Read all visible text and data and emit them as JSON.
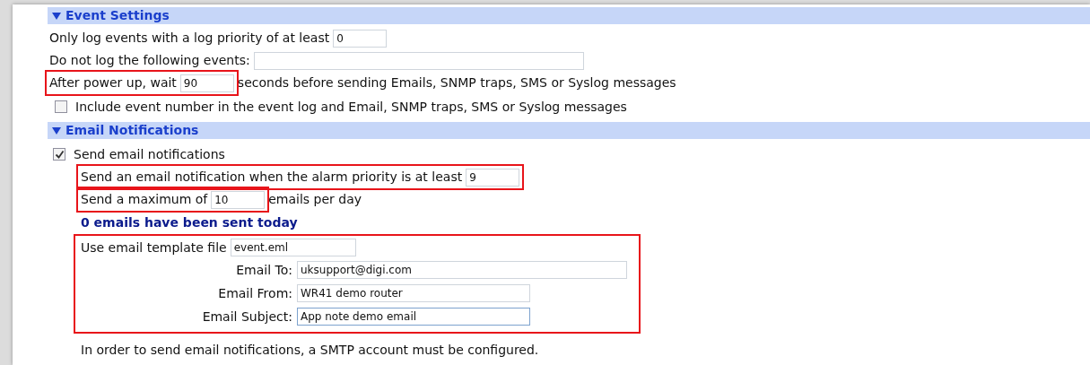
{
  "event_settings": {
    "title": "Event Settings",
    "expanded": true,
    "items": [
      {
        "kind": "field",
        "label": "Only log events with a log priority of at least",
        "value": "0",
        "highlighted": false
      },
      {
        "kind": "field",
        "label": "Do not log the following events:",
        "value": "",
        "highlighted": false
      },
      {
        "kind": "field",
        "label": "After power up, wait",
        "value": "90",
        "suffix": "seconds before sending Emails, SNMP traps, SMS or Syslog messages",
        "highlighted": true
      },
      {
        "kind": "checkbox",
        "label": "Include event number in the event log and Email, SNMP traps, SMS or Syslog messages",
        "checked": false
      }
    ]
  },
  "email_notifications": {
    "title": "Email Notifications",
    "expanded": true,
    "send": {
      "label": "Send email notifications",
      "checked": true
    },
    "items": [
      {
        "kind": "field",
        "label": "Send an email notification when the alarm priority is at least",
        "value": "9",
        "highlighted": true
      },
      {
        "kind": "field",
        "label": "Send a maximum of",
        "value": "10",
        "suffix": "emails per day",
        "highlighted": true
      }
    ],
    "status": "0 emails have been sent today",
    "template": {
      "label": "Use email template file",
      "value": "event.eml",
      "highlighted": true,
      "fields": [
        {
          "label": "Email To:",
          "value": "uksupport@digi.com",
          "focused": false
        },
        {
          "label": "Email From:",
          "value": "WR41 demo router",
          "focused": false
        },
        {
          "label": "Email Subject:",
          "value": "App note demo email",
          "focused": true
        }
      ]
    },
    "note": "In order to send email notifications, a SMTP account must be configured."
  }
}
